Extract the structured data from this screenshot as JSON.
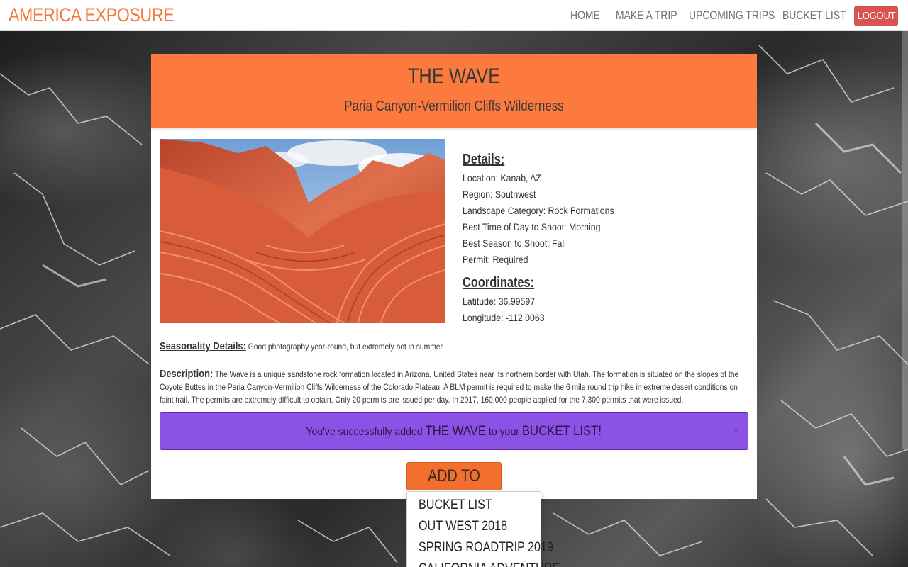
{
  "navbar": {
    "brand": "AMERICA EXPOSURE",
    "links": [
      "HOME",
      "MAKE A TRIP",
      "UPCOMING TRIPS",
      "BUCKET LIST"
    ],
    "logout": "LOGOUT"
  },
  "location": {
    "title": "THE WAVE",
    "subtitle": "Paria Canyon-Vermilion Cliffs Wilderness",
    "details_header": "Details:",
    "details": [
      "Location: Kanab, AZ",
      "Region: Southwest",
      "Landscape Category: Rock Formations",
      "Best Time of Day to Shoot: Morning",
      "Best Season to Shoot: Fall",
      "Permit: Required"
    ],
    "coordinates_header": "Coordinates:",
    "coordinates": [
      "Latitude: 36.99597",
      "Longitude: -112.0063"
    ],
    "seasonality_label": "Seasonality Details:",
    "seasonality_text": "Good photography year-round, but extremely hot in summer.",
    "description_label": "Description:",
    "description_text": "The Wave is a unique sandstone rock formation located in Arizona, United States near its northern border with Utah. The formation is situated on the slopes of the Coyote Buttes in the Paria Canyon-Vermilion Cliffs Wilderness of the Colorado Plateau. A BLM permit is required to make the 6 mile round trip hike in extreme desert conditions on faint trail. The permits are extremely difficult to obtain. Only 20 permits are issued per day. In 2017, 160,000 people applied for the 7,300 permits that were issued."
  },
  "alert": {
    "prefix": "You've successfully added",
    "place": "THE WAVE",
    "middle": "to your",
    "list": "BUCKET LIST!",
    "close": "×"
  },
  "add_to_trip": {
    "label": "ADD TO TRIP",
    "caret": "▾",
    "options": [
      "BUCKET LIST",
      "OUT WEST 2018",
      "SPRING ROADTRIP 2019",
      "CALIFORNIA ADVENTURE"
    ]
  },
  "colors": {
    "brand": "#f47a3c",
    "header": "#fd7a3f",
    "alert": "#8c52e5",
    "logout": "#d9534f"
  }
}
